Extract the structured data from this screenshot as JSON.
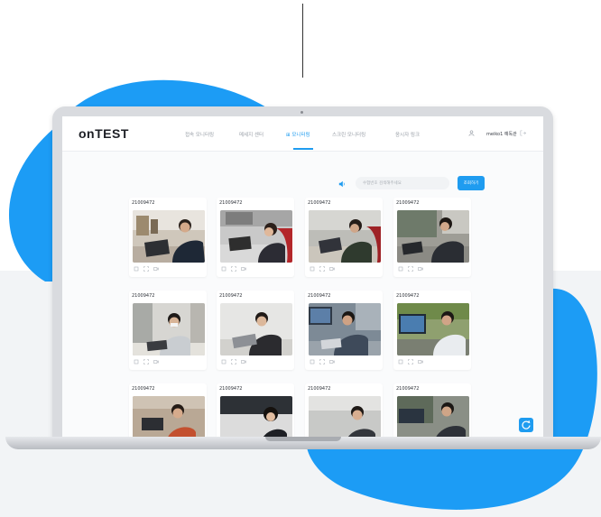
{
  "colors": {
    "accent": "#1f9cf0",
    "blob": "#1c9cf5",
    "page_band": "#f2f4f6"
  },
  "app": {
    "logo": "onTEST"
  },
  "nav": {
    "items": [
      {
        "label": "접속 모니터링",
        "active": false
      },
      {
        "label": "메세지 센터",
        "active": false
      },
      {
        "label": "⊞ 모니터링",
        "active": true
      },
      {
        "label": "스크린 모니터링",
        "active": false
      },
      {
        "label": "응시자 링크",
        "active": false
      }
    ]
  },
  "user": {
    "name": "meiko1 예독관",
    "icon": "user-icon",
    "logout_icon": "logout-icon"
  },
  "search": {
    "placeholder": "수험번호 검색해주세요",
    "button_label": "조회하기",
    "speaker_icon": "speaker-icon"
  },
  "cards": [
    {
      "id": "21009472",
      "scene": "office-left"
    },
    {
      "id": "21009472",
      "scene": "red-chair-woman"
    },
    {
      "id": "21009472",
      "scene": "red-chair-man"
    },
    {
      "id": "21009472",
      "scene": "window-man"
    },
    {
      "id": "21009472",
      "scene": "cubicle-masked"
    },
    {
      "id": "21009472",
      "scene": "white-desk"
    },
    {
      "id": "21009472",
      "scene": "monitor-man"
    },
    {
      "id": "21009472",
      "scene": "monitors-man"
    },
    {
      "id": "21009472",
      "scene": "partial"
    },
    {
      "id": "21009472",
      "scene": "partial-woman"
    },
    {
      "id": "21009472",
      "scene": "partial-man"
    },
    {
      "id": "21009472",
      "scene": "partial-office"
    }
  ],
  "card_action_icons": [
    "screen-icon",
    "expand-icon",
    "video-icon"
  ],
  "fab": {
    "icon": "refresh-icon"
  }
}
